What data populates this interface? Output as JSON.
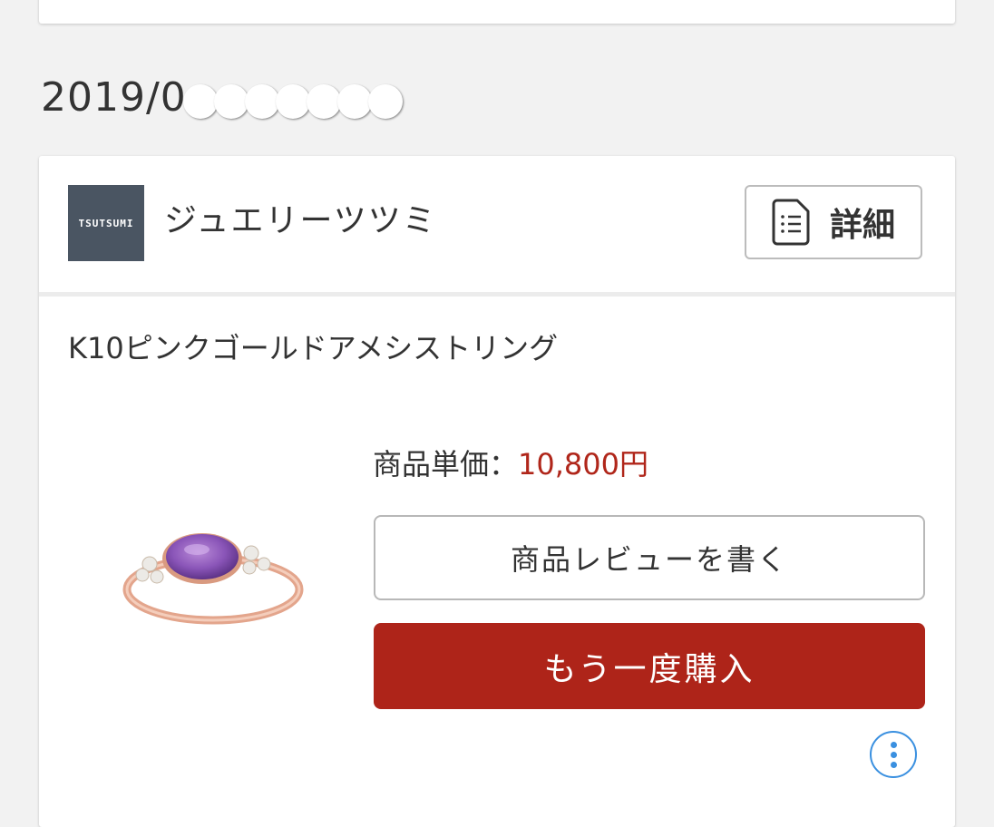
{
  "order": {
    "date_prefix": "2019/0"
  },
  "shop": {
    "logo_text": "TSUTSUMI",
    "name": "ジュエリーツツミ",
    "detail_label": "詳細"
  },
  "product": {
    "name": "K10ピンクゴールドアメシストリング",
    "price_label": "商品単価：",
    "price_value": "10,800円",
    "review_label": "商品レビューを書く",
    "buy_again_label": "もう一度購入"
  },
  "colors": {
    "accent_red": "#ae2419",
    "price_red": "#b0261a",
    "link_blue": "#3a90e0",
    "logo_bg": "#4a5562"
  },
  "icons": {
    "detail": "document-list-icon",
    "more": "more-vertical-icon"
  }
}
